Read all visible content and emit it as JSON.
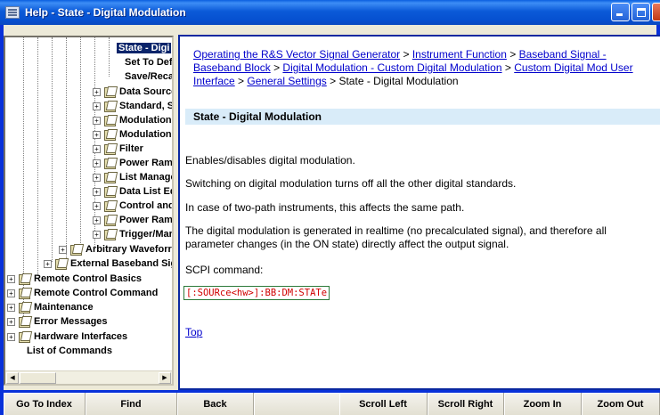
{
  "window": {
    "title": "Help -  State - Digital Modulation"
  },
  "tree": {
    "items": [
      {
        "label": "State - Digi",
        "selected": true
      },
      {
        "label": "Set To Defa"
      },
      {
        "label": "Save/Recal"
      },
      {
        "label": "Data Source"
      },
      {
        "label": "Standard, S"
      },
      {
        "label": "Modulation"
      },
      {
        "label": "Modulation"
      },
      {
        "label": "Filter"
      },
      {
        "label": "Power Ram"
      },
      {
        "label": "List Manage"
      },
      {
        "label": "Data List Ed"
      },
      {
        "label": "Control and"
      },
      {
        "label": "Power Ram"
      },
      {
        "label": "Trigger/Mar"
      },
      {
        "label": "Arbitrary Waveforr"
      },
      {
        "label": "External Baseband Sig"
      },
      {
        "label": "Remote Control Basics"
      },
      {
        "label": "Remote Control Command"
      },
      {
        "label": "Maintenance"
      },
      {
        "label": "Error Messages"
      },
      {
        "label": "Hardware Interfaces"
      },
      {
        "label": "List of Commands"
      }
    ]
  },
  "content": {
    "breadcrumb": {
      "links": [
        "Operating the R&S Vector Signal Generator",
        "Instrument Function",
        "Baseband Signal - Baseband Block",
        "Digital Modulation - Custom Digital Modulation",
        "Custom Digital Mod User Interface",
        "General Settings"
      ],
      "separator": " > ",
      "current": "State - Digital Modulation"
    },
    "heading": "State - Digital Modulation",
    "paragraphs": [
      "Enables/disables digital modulation.",
      "Switching on digital modulation turns off all the other digital standards.",
      "In case of two-path instruments, this affects the same path.",
      "The digital modulation is generated in realtime (no precalculated signal), and therefore all parameter changes (in the ON state) directly affect the output signal.",
      "SCPI command:"
    ],
    "scpi": "[:SOURce<hw>]:BB:DM:STATe",
    "top_link": "Top"
  },
  "buttons": {
    "go_to_index": "Go To Index",
    "find": "Find",
    "back": "Back",
    "scroll_left": "Scroll Left",
    "scroll_right": "Scroll Right",
    "zoom_in": "Zoom In",
    "zoom_out": "Zoom Out"
  },
  "icons": {
    "app": "help-window-icon",
    "minimize": "minimize-icon",
    "maximize": "maximize-icon",
    "close": "close-icon",
    "folder": "folder-book-icon",
    "expand": "plus-expander-icon"
  }
}
